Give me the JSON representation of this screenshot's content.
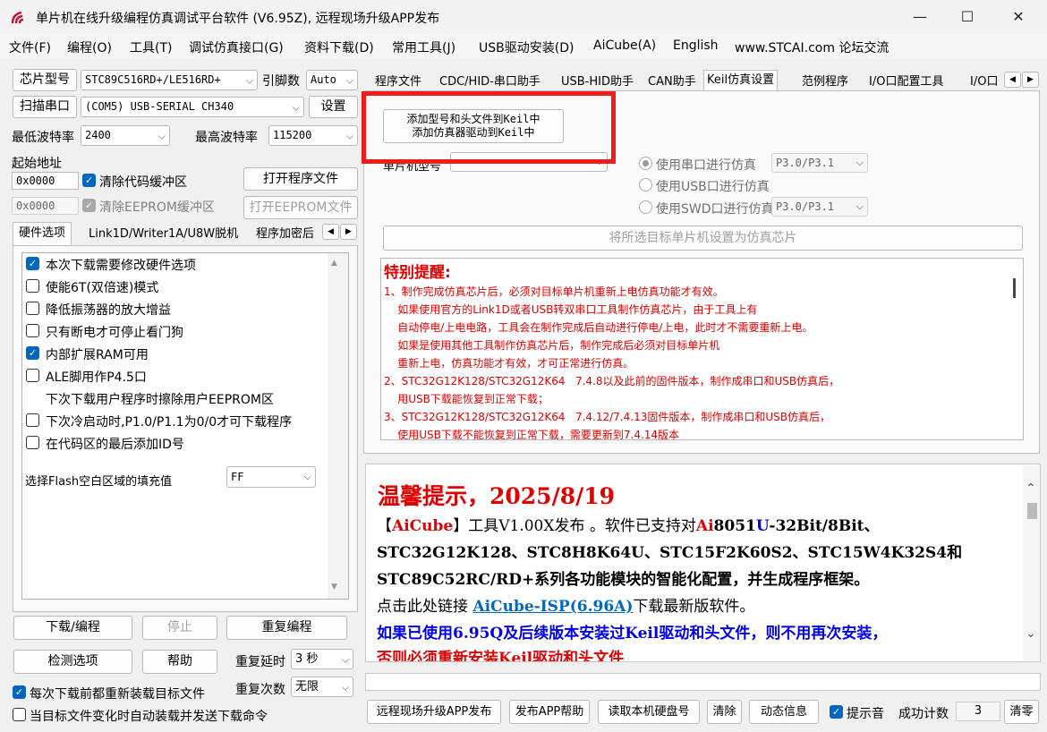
{
  "window": {
    "title": "单片机在线升级编程仿真调试平台软件 (V6.95Z), 远程现场升级APP发布",
    "minimize": "—",
    "maximize": "☐",
    "close": "✕"
  },
  "menu": [
    "文件(F)",
    "编程(O)",
    "工具(T)",
    "调试仿真接口(G)",
    "资料下载(D)",
    "常用工具(J)",
    "USB驱动安装(D)",
    "AiCube(A)",
    "English",
    "www.STCAI.com 论坛交流"
  ],
  "left": {
    "chip_type_btn": "芯片型号",
    "chip_value": "STC89C516RD+/LE516RD+",
    "pin_label": "引脚数",
    "pin_value": "Auto",
    "scan_btn": "扫描串口",
    "port_value": "(COM5) USB-SERIAL CH340",
    "settings_btn": "设置",
    "min_baud_label": "最低波特率",
    "min_baud_value": "2400",
    "max_baud_label": "最高波特率",
    "max_baud_value": "115200",
    "start_addr_label": "起始地址",
    "addr1": "0x0000",
    "clear_code_label": "清除代码缓冲区",
    "open_prog_btn": "打开程序文件",
    "addr2": "0x0000",
    "clear_eeprom_label": "清除EEPROM缓冲区",
    "open_eeprom_btn": "打开EEPROM文件",
    "tabs": [
      "硬件选项",
      "Link1D/Writer1A/U8W脱机",
      "程序加密后"
    ],
    "options": [
      {
        "label": "本次下载需要修改硬件选项",
        "state": "on"
      },
      {
        "label": "使能6T(双倍速)模式",
        "state": "off"
      },
      {
        "label": "降低振荡器的放大增益",
        "state": "off"
      },
      {
        "label": "只有断电才可停止看门狗",
        "state": "off"
      },
      {
        "label": "内部扩展RAM可用",
        "state": "on"
      },
      {
        "label": "ALE脚用作P4.5口",
        "state": "off"
      },
      {
        "label": "下次下载用户程序时擦除用户EEPROM区",
        "state": "none"
      },
      {
        "label": "下次冷启动时,P1.0/P1.1为0/0才可下载程序",
        "state": "off"
      },
      {
        "label": "在代码区的最后添加ID号",
        "state": "off"
      }
    ],
    "fill_label": "选择Flash空白区域的填充值",
    "fill_value": "FF",
    "download_btn": "下载/编程",
    "stop_btn": "停止",
    "reprogram_btn": "重复编程",
    "detect_btn": "检测选项",
    "help_btn": "帮助",
    "repeat_delay_label": "重复延时",
    "repeat_delay_value": "3 秒",
    "repeat_count_label": "重复次数",
    "repeat_count_value": "无限",
    "reload_label": "每次下载前都重新装载目标文件",
    "auto_label": "当目标文件变化时自动装载并发送下载命令"
  },
  "right": {
    "tabs": [
      "程序文件",
      "CDC/HID-串口助手",
      "USB-HID助手",
      "CAN助手",
      "Keil仿真设置",
      "范例程序",
      "I/O口配置工具",
      "I/O口"
    ],
    "add_btn_line1": "添加型号和头文件到Keil中",
    "add_btn_line2": "添加仿真器驱动到Keil中",
    "chip_label_partial": "单片机型号",
    "radio1": "使用串口进行仿真",
    "radio1_value": "P3.0/P3.1",
    "radio2": "使用USB口进行仿真",
    "radio3": "使用SWD口进行仿真",
    "radio3_value": "P3.0/P3.1",
    "set_chip_btn": "将所选目标单片机设置为仿真芯片",
    "notice_title": "特别提醒:",
    "notice_lines": [
      "1、制作完成仿真芯片后，必须对目标单片机重新上电仿真功能才有效。",
      "    如果使用官方的Link1D或者USB转双串口工具制作仿真芯片，由于工具上有",
      "    自动停电/上电电路，工具会在制作完成后自动进行停电/上电，此时才不需要重新上电。",
      "    如果是使用其他工具制作仿真芯片后，制作完成后必须对目标单片机",
      "    重新上电，仿真功能才有效，才可正常进行仿真。",
      "2、STC32G12K128/STC32G12K64   7.4.8以及此前的固件版本，制作成串口和USB仿真后，",
      "    用USB下载能恢复到正常下载；",
      "3、STC32G12K128/STC32G12K64   7.4.12/7.4.13固件版本，制作成串口和USB仿真后，",
      "    使用USB下载不能恢复到正常下载，需要更新到7.4.14版本"
    ],
    "news_title": "温馨提示，2025/8/19",
    "news_l1_a": "【",
    "news_l1_b": "AiCube",
    "news_l1_c": "】工具V1.00X发布 。软件已支持对",
    "news_l1_d": "Ai",
    "news_l1_e": "8051",
    "news_l1_f": "U",
    "news_l1_g": "-32Bit/8Bit、",
    "news_l2": "STC32G12K128、STC8H8K64U、STC15F2K60S2、STC15W4K32S4和",
    "news_l3": "STC89C52RC/RD+系列各功能模块的智能化配置，并生成程序框架。",
    "news_l4_a": "点击此处链接 ",
    "news_l4_link": "AiCube-ISP(6.96A)",
    "news_l4_b": "下载最新版软件。",
    "news_l5": "如果已使用6.95Q及后续版本安装过Keil驱动和头文件，则不用再次安装，",
    "news_l6": "否则必须重新安装Keil驱动和头文件",
    "bottom_btns": [
      "远程现场升级APP发布",
      "发布APP帮助",
      "读取本机硬盘号",
      "清除",
      "动态信息"
    ],
    "beep_label": "提示音",
    "count_label": "成功计数",
    "count_value": "3",
    "clear_btn": "清零"
  },
  "colors": {
    "accent": "#0067c0",
    "highlight_box": "#ee1c1c",
    "red_text": "#e00000",
    "blue_text": "#0000ee"
  }
}
